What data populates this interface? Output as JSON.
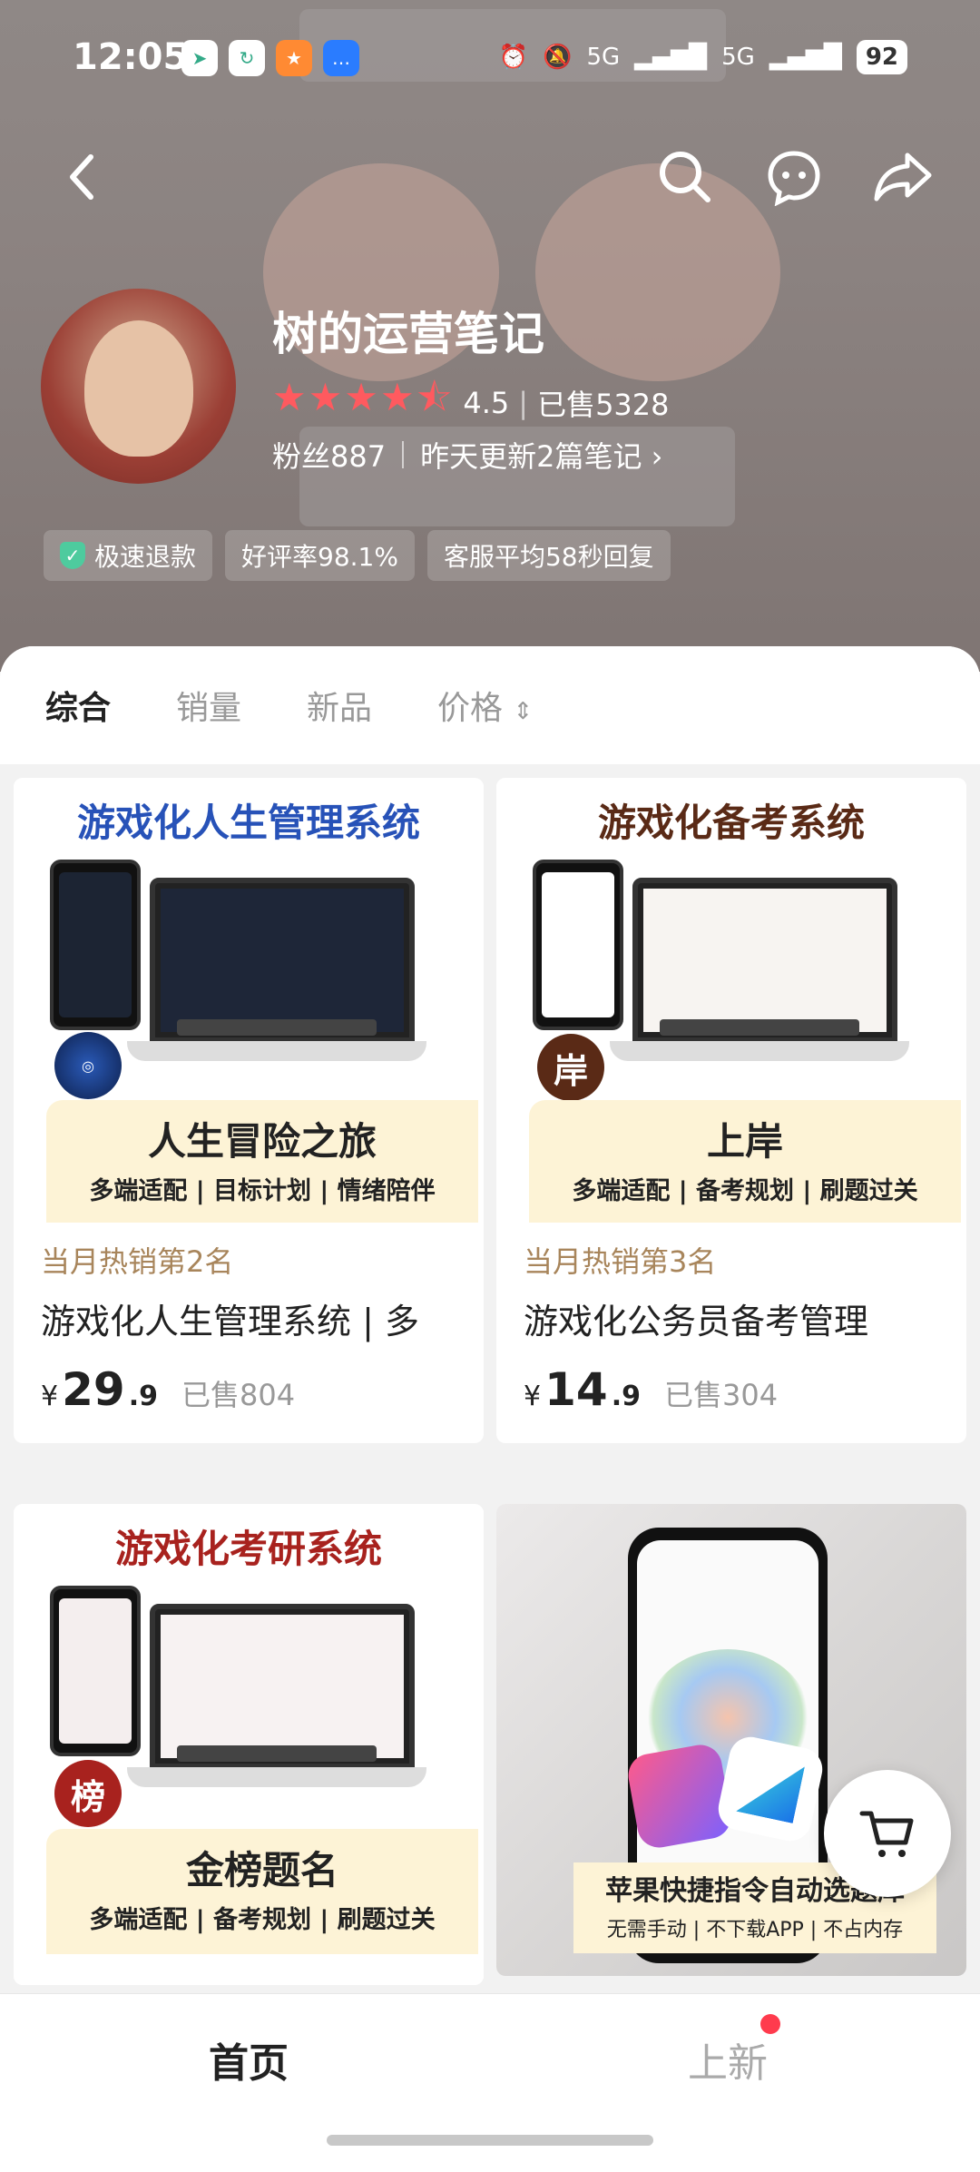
{
  "status_bar": {
    "time": "12:05",
    "network_1": "5G",
    "network_2": "5G",
    "battery": "92"
  },
  "store": {
    "name": "树的运营笔记",
    "rating": "4.5",
    "sold": "已售5328",
    "fans": "粉丝887",
    "update": "昨天更新2篇笔记",
    "tags": [
      "极速退款",
      "好评率98.1%",
      "客服平均58秒回复"
    ]
  },
  "sort_tabs": {
    "comprehensive": "综合",
    "sales": "销量",
    "new": "新品",
    "price": "价格"
  },
  "products": [
    {
      "thumb_title": "游戏化人生管理系统",
      "thumb_title_color": "#2752b8",
      "badge_text": "",
      "banner_big": "人生冒险之旅",
      "banner_small": "多端适配 | 目标计划 | 情绪陪伴",
      "rank": "当月热销第2名",
      "name": "游戏化人生管理系统 | 多",
      "price_yen": "¥",
      "price_int": "29",
      "price_dec": ".9",
      "sold": "已售804"
    },
    {
      "thumb_title": "游戏化备考系统",
      "thumb_title_color": "#5a2a16",
      "badge_text": "岸",
      "banner_big": "上岸",
      "banner_small": "多端适配 | 备考规划 | 刷题过关",
      "rank": "当月热销第3名",
      "name": "游戏化公务员备考管理",
      "price_yen": "¥",
      "price_int": "14",
      "price_dec": ".9",
      "sold": "已售304"
    },
    {
      "thumb_title": "游戏化考研系统",
      "thumb_title_color": "#a8221e",
      "badge_text": "榜",
      "banner_big": "金榜题名",
      "banner_small": "多端适配 | 备考规划 | 刷题过关"
    },
    {
      "caption_big": "苹果快捷指令自动选题库",
      "caption_small": "无需手动 | 不下载APP | 不占内存"
    }
  ],
  "bottom_nav": {
    "home": "首页",
    "new": "上新"
  }
}
